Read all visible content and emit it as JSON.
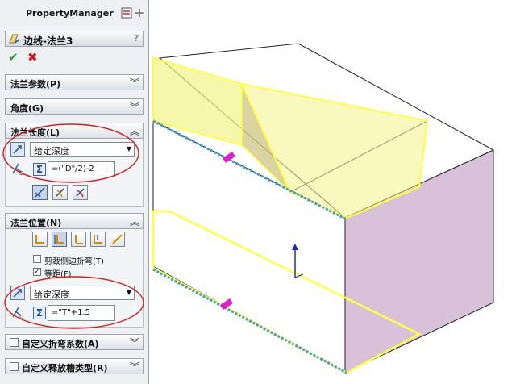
{
  "header": {
    "title": "PropertyManager"
  },
  "feature": {
    "title": "边线-法兰3",
    "help": "?"
  },
  "actions": {
    "ok": "✔",
    "cancel": "✖"
  },
  "sections": {
    "flange_params": {
      "label": "法兰参数(P)",
      "chevron": "︾"
    },
    "angle": {
      "label": "角度(G)",
      "chevron": "︾"
    },
    "flange_length": {
      "label": "法兰长度(L)",
      "chevron": "︽",
      "end_condition": "给定深度",
      "length_value": "=(\"D\"/2)-2"
    },
    "flange_position": {
      "label": "法兰位置(N)",
      "chevron": "︽",
      "trim_side_bends": "剪裁侧边折弯(T)",
      "equal_distance": "等距(F)",
      "equal_distance_checked": "✓",
      "offset_condition": "给定深度",
      "offset_value": "=\"T\"+1.5"
    },
    "custom_bend_allowance": {
      "label": "自定义折弯系数(A)",
      "chevron": "︾"
    },
    "custom_relief": {
      "label": "自定义释放槽类型(R)",
      "chevron": "︾"
    }
  },
  "colors": {
    "highlight": "#f4f28a",
    "side_face": "#d9c2d9",
    "annotation": "#d01f1f",
    "preview_edge": "#ffff44"
  }
}
